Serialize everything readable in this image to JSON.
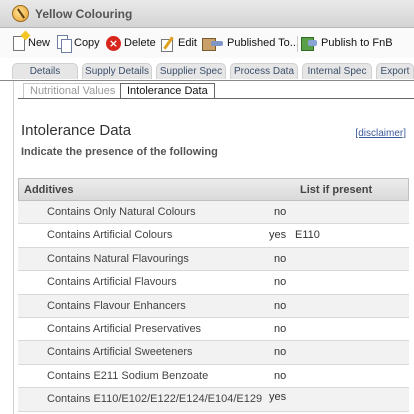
{
  "window": {
    "title": "Yellow Colouring"
  },
  "toolbar": {
    "new": "New",
    "copy": "Copy",
    "delete": "Delete",
    "edit": "Edit",
    "published_to": "Published To...",
    "publish_fnb": "Publish to FnB"
  },
  "tabs": [
    "Details",
    "Supply Details",
    "Supplier Spec",
    "Process Data",
    "Internal Spec",
    "Export"
  ],
  "subtabs": {
    "nutritional": "Nutritional Values",
    "intolerance": "Intolerance Data"
  },
  "section": {
    "title": "Intolerance Data",
    "disclaimer": "[disclaimer]",
    "subtitle": "Indicate the presence of the following"
  },
  "table": {
    "col_additives": "Additives",
    "col_list": "List if present",
    "rows": [
      {
        "label": "Contains Only Natural Colours",
        "value": "no",
        "extra": ""
      },
      {
        "label": "Contains Artificial Colours",
        "value": "yes",
        "extra": "E110"
      },
      {
        "label": "Contains Natural Flavourings",
        "value": "no",
        "extra": ""
      },
      {
        "label": "Contains Artificial Flavours",
        "value": "no",
        "extra": ""
      },
      {
        "label": "Contains Flavour Enhancers",
        "value": "no",
        "extra": ""
      },
      {
        "label": "Contains Artificial Preservatives",
        "value": "no",
        "extra": ""
      },
      {
        "label": "Contains Artificial Sweeteners",
        "value": "no",
        "extra": ""
      },
      {
        "label": "Contains E211 Sodium Benzoate",
        "value": "no",
        "extra": ""
      },
      {
        "label": "Contains E110/E102/E122/E124/E104/E129",
        "value": "yes",
        "extra": ""
      }
    ]
  },
  "icons": {
    "title": "paint-icon",
    "new": "new-document-icon",
    "copy": "copy-icon",
    "delete": "delete-icon",
    "edit": "edit-icon",
    "published_to": "publish-icon",
    "publish_fnb": "publish-fnb-icon"
  },
  "colors": {
    "link": "#3b5a9a",
    "delete": "#d9261c",
    "tab_text": "#3c4f6b"
  }
}
